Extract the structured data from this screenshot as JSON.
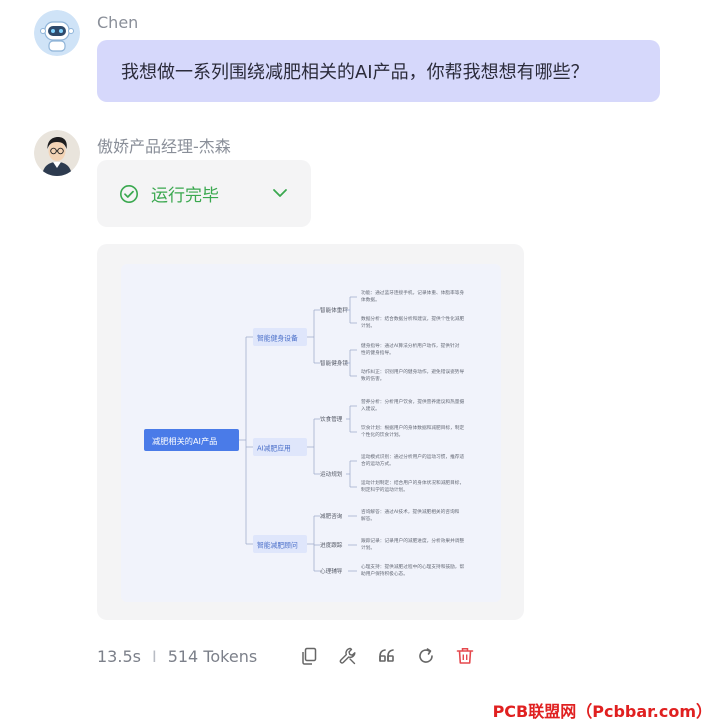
{
  "user": {
    "name": "Chen",
    "message": "我想做一系列围绕减肥相关的AI产品，你帮我想想有哪些？"
  },
  "assistant": {
    "name": "傲娇产品经理-杰森",
    "status_label": "运行完毕",
    "stats": {
      "time": "13.5s",
      "separator": "I",
      "tokens": "514 Tokens"
    }
  },
  "mindmap": {
    "root": "减肥相关的AI产品",
    "branches": [
      {
        "label": "智能健身设备",
        "children": [
          {
            "label": "智能体重秤",
            "leaves": [
              "功能：通过蓝牙连接手机，记录体重、体脂率等身体数据。",
              "数据分析：结合数据分析和建议，提供个性化减肥计划。"
            ]
          },
          {
            "label": "智能健身镜",
            "leaves": [
              "健身指导：通过AI算法分析用户动作，提供针对性的健身指导。",
              "动作纠正：识别用户的健身动作，避免错误姿势导致的伤害。"
            ]
          }
        ]
      },
      {
        "label": "AI减肥应用",
        "children": [
          {
            "label": "饮食管理",
            "leaves": [
              "营养分析：分析用户饮食，提供营养建议和热量摄入建议。",
              "饮食计划：根据用户的身体数据和减肥目标，制定个性化的饮食计划。"
            ]
          },
          {
            "label": "运动规划",
            "leaves": [
              "运动模式识别：通过分析用户的运动习惯，推荐适合的运动方式。",
              "运动计划制定：结合用户的身体状况和减肥目标，制定科学的运动计划。"
            ]
          }
        ]
      },
      {
        "label": "智能减肥顾问",
        "children": [
          {
            "label": "减肥咨询",
            "leaves": [
              "咨询解答：通过AI技术，提供减肥相关的咨询和解答。"
            ]
          },
          {
            "label": "进度跟踪",
            "leaves": [
              "跟踪记录：记录用户的减肥进度，分析效果并调整计划。"
            ]
          },
          {
            "label": "心理辅导",
            "leaves": [
              "心理支持：提供减肥过程中的心理支持和鼓励，帮助用户保持积极心态。"
            ]
          }
        ]
      }
    ]
  },
  "watermark": "PCB联盟网（Pcbbar.com）",
  "colors": {
    "accent": "#d6d8fb",
    "success": "#3aa84f",
    "danger": "#e5484d",
    "root": "#4a7be8"
  }
}
